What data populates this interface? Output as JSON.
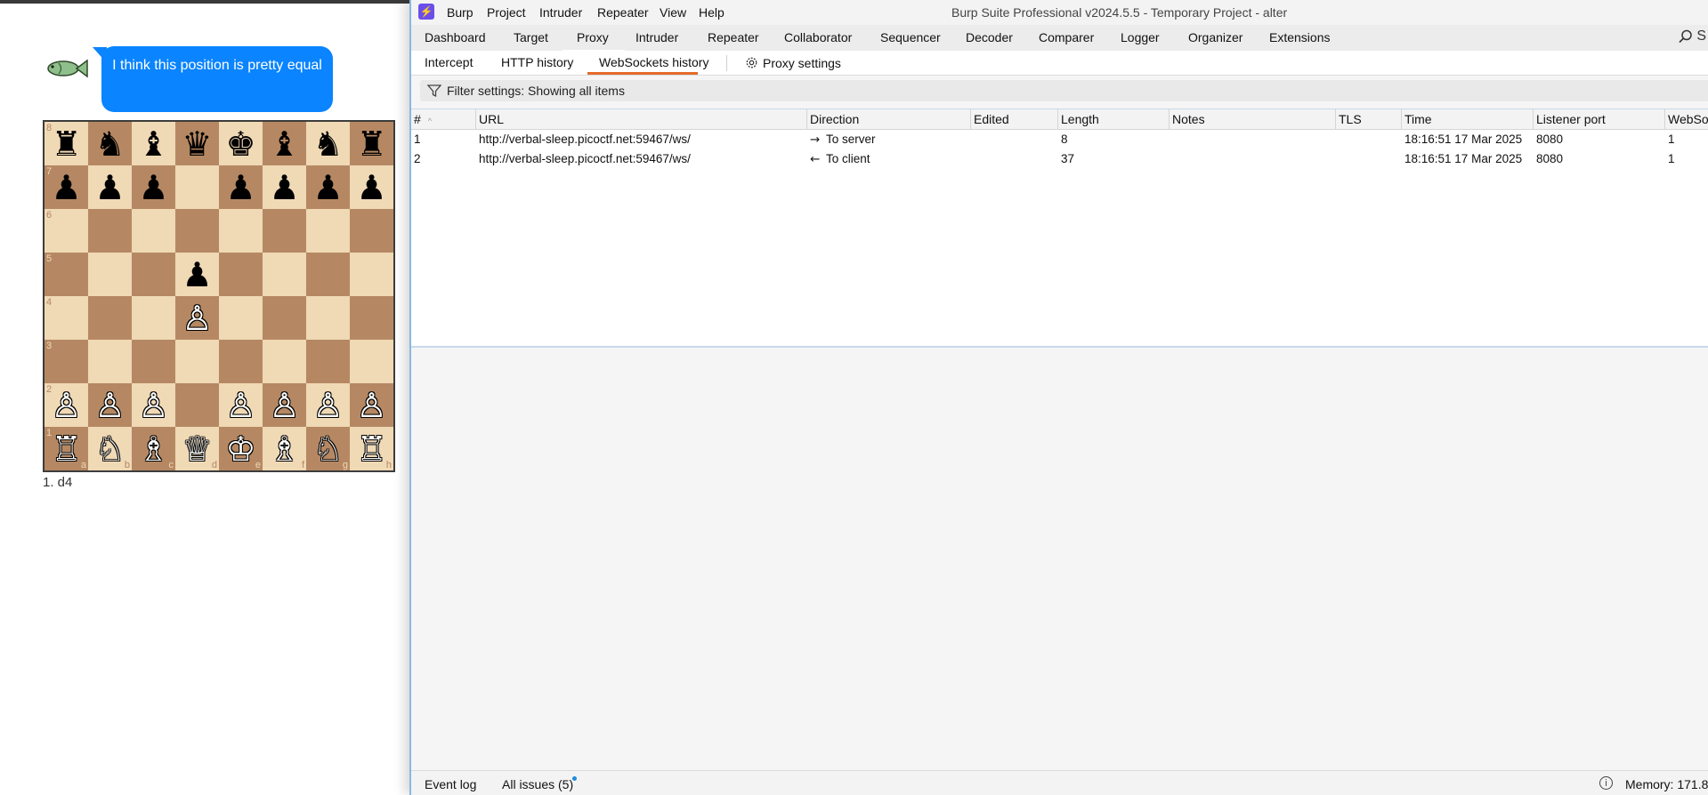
{
  "chat": {
    "message": "I think this position is pretty equal"
  },
  "chess": {
    "ranks": [
      "8",
      "7",
      "6",
      "5",
      "4",
      "3",
      "2",
      "1"
    ],
    "files": [
      "a",
      "b",
      "c",
      "d",
      "e",
      "f",
      "g",
      "h"
    ],
    "board": [
      [
        "♜",
        "♞",
        "♝",
        "♛",
        "♚",
        "♝",
        "♞",
        "♜"
      ],
      [
        "♟",
        "♟",
        "♟",
        "",
        "♟",
        "♟",
        "♟",
        "♟"
      ],
      [
        "",
        "",
        "",
        "",
        "",
        "",
        "",
        ""
      ],
      [
        "",
        "",
        "",
        "♟",
        "",
        "",
        "",
        ""
      ],
      [
        "",
        "",
        "",
        "♙",
        "",
        "",
        "",
        ""
      ],
      [
        "",
        "",
        "",
        "",
        "",
        "",
        "",
        ""
      ],
      [
        "♙",
        "♙",
        "♙",
        "",
        "♙",
        "♙",
        "♙",
        "♙"
      ],
      [
        "♖",
        "♘",
        "♗",
        "♕",
        "♔",
        "♗",
        "♘",
        "♖"
      ]
    ],
    "moves": "1. d4"
  },
  "burp": {
    "logo": "⚡",
    "menu": [
      "Burp",
      "Project",
      "Intruder",
      "Repeater",
      "View",
      "Help"
    ],
    "title": "Burp Suite Professional v2024.5.5 - Temporary Project - alter",
    "main_tabs": [
      "Dashboard",
      "Target",
      "Proxy",
      "Intruder",
      "Repeater",
      "Collaborator",
      "Sequencer",
      "Decoder",
      "Comparer",
      "Logger",
      "Organizer",
      "Extensions"
    ],
    "search_letter": "S",
    "proxy_tabs": [
      "Intercept",
      "HTTP history",
      "WebSockets history"
    ],
    "proxy_settings_label": "Proxy settings",
    "filter_text": "Filter settings: Showing all items",
    "columns": [
      "#",
      "URL",
      "Direction",
      "Edited",
      "Length",
      "Notes",
      "TLS",
      "Time",
      "Listener port",
      "WebSo"
    ],
    "rows": [
      {
        "num": "1",
        "url": "http://verbal-sleep.picoctf.net:59467/ws/",
        "arrow": "→",
        "direction": "To server",
        "edited": "",
        "length": "8",
        "notes": "",
        "tls": "",
        "time": "18:16:51 17 Mar 2025",
        "port": "8080",
        "websocket": "1"
      },
      {
        "num": "2",
        "url": "http://verbal-sleep.picoctf.net:59467/ws/",
        "arrow": "←",
        "direction": "To client",
        "edited": "",
        "length": "37",
        "notes": "",
        "tls": "",
        "time": "18:16:51 17 Mar 2025",
        "port": "8080",
        "websocket": "1"
      }
    ],
    "status": {
      "event_log": "Event log",
      "all_issues": "All issues (5)",
      "info_glyph": "i",
      "memory": "Memory: 171.8"
    },
    "colors": {
      "accent": "#e56b2b",
      "logo": "#6b4eea",
      "bubble": "#0a84ff"
    }
  }
}
